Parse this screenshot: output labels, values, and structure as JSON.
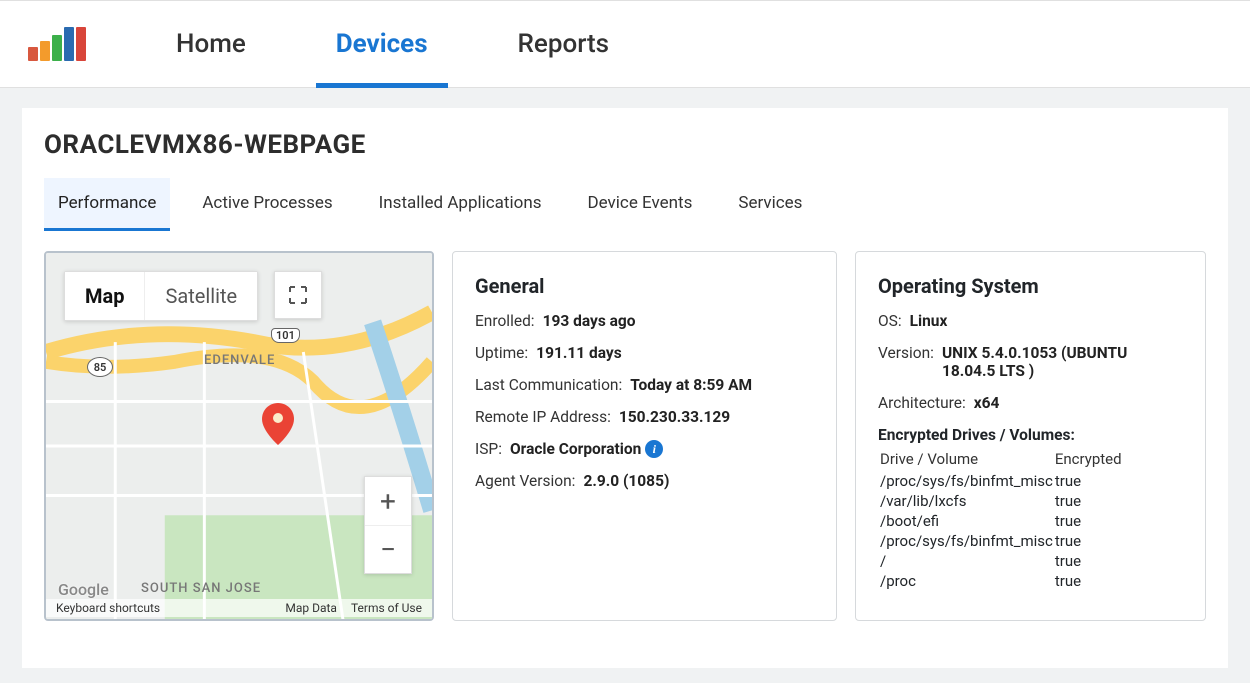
{
  "nav": {
    "home": "Home",
    "devices": "Devices",
    "reports": "Reports"
  },
  "page": {
    "title": "ORACLEVMX86-WEBPAGE"
  },
  "subtabs": {
    "performance": "Performance",
    "active_processes": "Active Processes",
    "installed_applications": "Installed Applications",
    "device_events": "Device Events",
    "services": "Services"
  },
  "map": {
    "map_label": "Map",
    "satellite_label": "Satellite",
    "hwy101": "101",
    "hwy85": "85",
    "place_edenvale": "EDENVALE",
    "place_ssj": "SOUTH SAN JOSE",
    "google": "Google",
    "footer": {
      "shortcuts": "Keyboard shortcuts",
      "mapdata": "Map Data",
      "terms": "Terms of Use"
    }
  },
  "general": {
    "title": "General",
    "enrolled_label": "Enrolled:",
    "enrolled_value": "193 days ago",
    "uptime_label": "Uptime:",
    "uptime_value": "191.11 days",
    "lastcomm_label": "Last Communication:",
    "lastcomm_value": "Today at 8:59 AM",
    "remoteip_label": "Remote IP Address:",
    "remoteip_value": "150.230.33.129",
    "isp_label": "ISP:",
    "isp_value": "Oracle Corporation",
    "agent_label": "Agent Version:",
    "agent_value": "2.9.0 (1085)"
  },
  "os": {
    "title": "Operating System",
    "os_label": "OS:",
    "os_value": "Linux",
    "version_label": "Version:",
    "version_value": "UNIX 5.4.0.1053 (UBUNTU 18.04.5 LTS )",
    "arch_label": "Architecture:",
    "arch_value": "x64",
    "drives_header": "Encrypted Drives / Volumes:",
    "drives_col1": "Drive / Volume",
    "drives_col2": "Encrypted",
    "drives": [
      {
        "vol": "/proc/sys/fs/binfmt_misc",
        "enc": "true"
      },
      {
        "vol": "/var/lib/lxcfs",
        "enc": "true"
      },
      {
        "vol": "/boot/efi",
        "enc": "true"
      },
      {
        "vol": "/proc/sys/fs/binfmt_misc",
        "enc": "true"
      },
      {
        "vol": "/",
        "enc": "true"
      },
      {
        "vol": "/proc",
        "enc": "true"
      }
    ]
  }
}
